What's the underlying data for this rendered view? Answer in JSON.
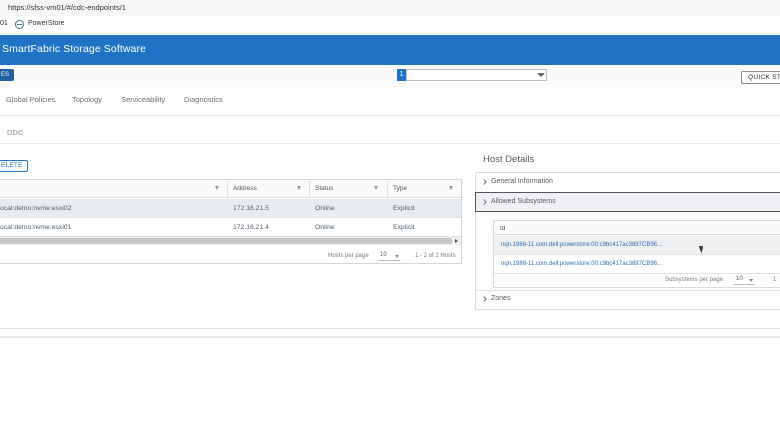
{
  "browser": {
    "url": "https://sfss-vm01/#/cdc-endpoints/1",
    "bookmark_prefix": "01",
    "bookmark_label": "PowerStore"
  },
  "header": {
    "title": "SmartFabric Storage Software",
    "brand_color": "#1f72c4"
  },
  "toolbar": {
    "left_button": "ES",
    "selector_value": "1",
    "quick_button": "QUICK STA"
  },
  "nav": {
    "tabs": [
      "Global Policies",
      "Topology",
      "Serviceability",
      "Diagnostics"
    ]
  },
  "breadcrumb": "DDC",
  "hosts": {
    "delete_label": "ELETE",
    "columns": [
      "",
      "Address",
      "Status",
      "Type"
    ],
    "rows": [
      {
        "name": "ocal:demo:nvme:esxi02",
        "address": "172.16.21.5",
        "status": "Online",
        "type": "Explicit"
      },
      {
        "name": "ocal:demo:nvme:esxi01",
        "address": "172.16.21.4",
        "status": "Online",
        "type": "Explicit"
      }
    ],
    "footer": {
      "per_page_label": "Hosts per page",
      "per_page_value": "10",
      "range": "1 - 2 of 2 Hosts"
    }
  },
  "host_details": {
    "title": "Host Details",
    "sections": {
      "general": "General Information",
      "allowed": "Allowed Subsystems",
      "zones": "Zones"
    },
    "subsystems": {
      "column": "Id",
      "rows": [
        "nqn.1988-11.com.dell:powerstore:00:c9bc417ac3897CB96...",
        "nqn.1988-11.com.dell:powerstore:00:c9bc417ac3897CB96..."
      ],
      "per_page_label": "Subsystems per page",
      "per_page_value": "10",
      "range": "1"
    }
  }
}
